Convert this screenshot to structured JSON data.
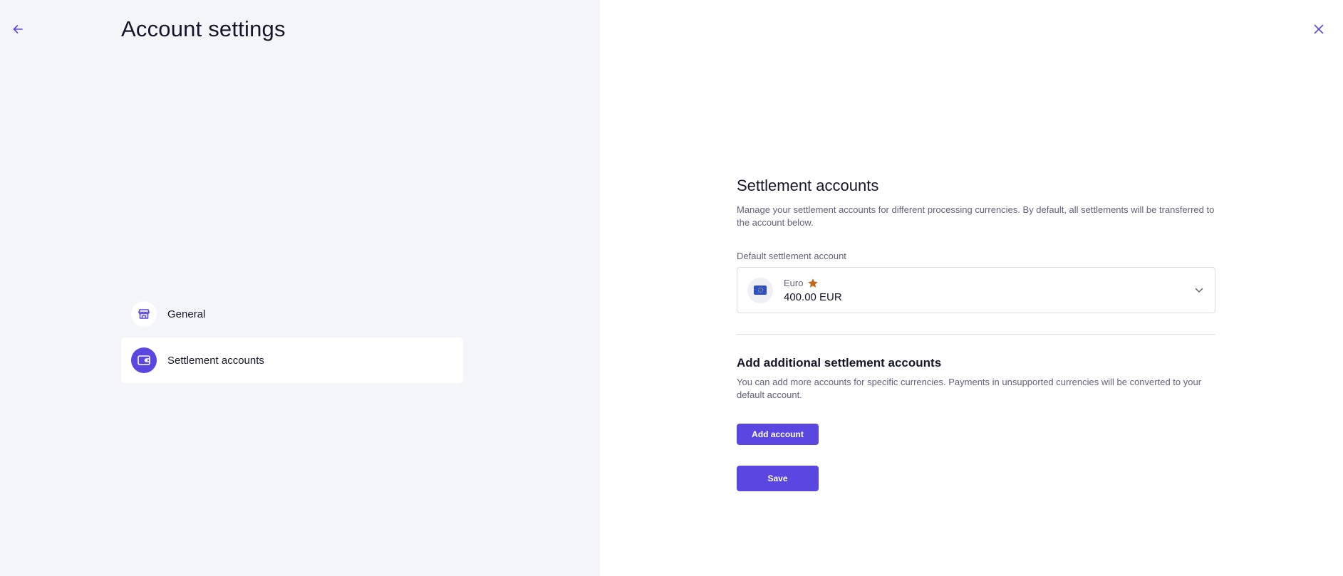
{
  "header": {
    "title": "Account settings",
    "back_icon": "arrow-left-icon",
    "close_icon": "close-icon"
  },
  "sidebar": {
    "items": [
      {
        "label": "General",
        "icon": "store-icon",
        "active": false
      },
      {
        "label": "Settlement accounts",
        "icon": "wallet-icon",
        "active": true
      }
    ]
  },
  "main": {
    "title": "Settlement accounts",
    "description": "Manage your settlement accounts for different processing currencies. By default, all settlements will be transferred to the account below.",
    "default_account_label": "Default settlement account",
    "default_account": {
      "currency_name": "Euro",
      "amount": "400.00 EUR",
      "icon": "eu-flag-icon",
      "badge_icon": "star-icon"
    },
    "additional": {
      "title": "Add additional settlement accounts",
      "description": "You can add more accounts for specific currencies. Payments in unsupported currencies will be converted to your default account.",
      "add_button": "Add account"
    },
    "save_button": "Save"
  },
  "colors": {
    "accent": "#5a46e0",
    "star": "#c0651a",
    "left_panel_bg": "#f4f5f9",
    "text_primary": "#16162a",
    "text_secondary": "#62627a"
  }
}
